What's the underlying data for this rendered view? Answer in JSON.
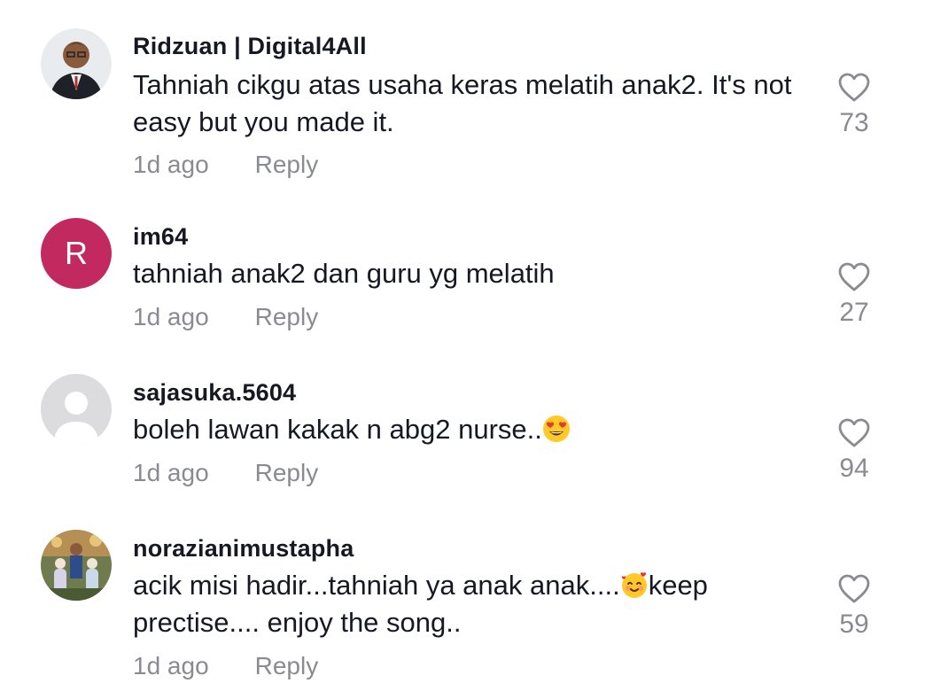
{
  "comments": [
    {
      "username": "Ridzuan | Digital4All",
      "text": "Tahniah cikgu atas usaha keras melatih anak2. It's not easy but you made it.",
      "time": "1d ago",
      "reply_label": "Reply",
      "likes": "73",
      "avatar": "photo"
    },
    {
      "username": "im64",
      "text": "tahniah anak2 dan guru yg melatih",
      "time": "1d ago",
      "reply_label": "Reply",
      "likes": "27",
      "avatar_letter": "R",
      "avatar_color": "#c1295f"
    },
    {
      "username": "sajasuka.5604",
      "text_before": "boleh lawan kakak n abg2 nurse..",
      "emoji": "heart-eyes-emoji",
      "time": "1d ago",
      "reply_label": "Reply",
      "likes": "94",
      "avatar": "default-silhouette"
    },
    {
      "username": "norazianimustapha",
      "text_part1": "acik misi hadir...tahniah ya anak anak....",
      "emoji": "smiling-face-with-hearts-emoji",
      "text_part2": "keep prectise.... enjoy the song..",
      "time": "1d ago",
      "reply_label": "Reply",
      "likes": "59",
      "avatar": "photo"
    }
  ],
  "colors": {
    "text": "#161823",
    "secondary": "#8a8b91",
    "avatar_letter_bg": "#c1295f"
  }
}
